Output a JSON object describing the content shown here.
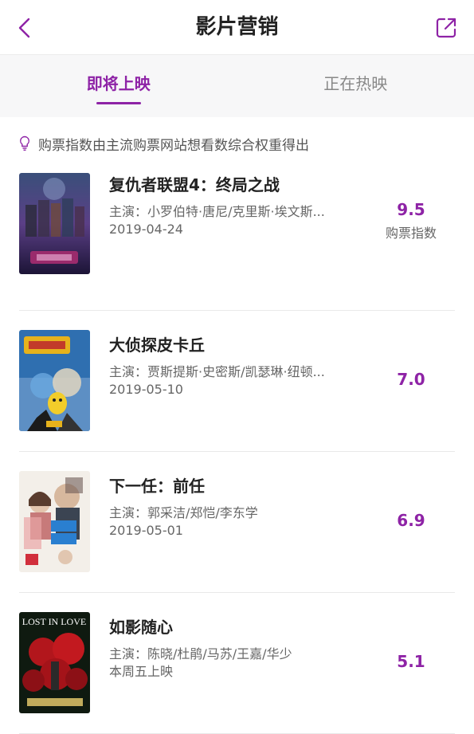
{
  "header": {
    "title": "影片营销"
  },
  "tabs": [
    {
      "label": "即将上映",
      "active": true
    },
    {
      "label": "正在热映",
      "active": false
    }
  ],
  "tip": {
    "text": "购票指数由主流购票网站想看数综合权重得出"
  },
  "score_label": "购票指数",
  "movies": [
    {
      "title": "复仇者联盟4：终局之战",
      "cast": "主演：小罗伯特·唐尼/克里斯·埃文斯...",
      "date": "2019-04-24",
      "score": "9.5"
    },
    {
      "title": "大侦探皮卡丘",
      "cast": "主演：贾斯提斯·史密斯/凯瑟琳·纽顿...",
      "date": "2019-05-10",
      "score": "7.0"
    },
    {
      "title": "下一任：前任",
      "cast": "主演：郭采洁/郑恺/李东学",
      "date": "2019-05-01",
      "score": "6.9"
    },
    {
      "title": "如影随心",
      "cast": "主演：陈晓/杜鹃/马苏/王嘉/华少",
      "date": "本周五上映",
      "score": "5.1"
    }
  ],
  "poster_text": {
    "lost_in_love": "LOST IN LOVE"
  },
  "colors": {
    "accent": "#8e23a6"
  }
}
